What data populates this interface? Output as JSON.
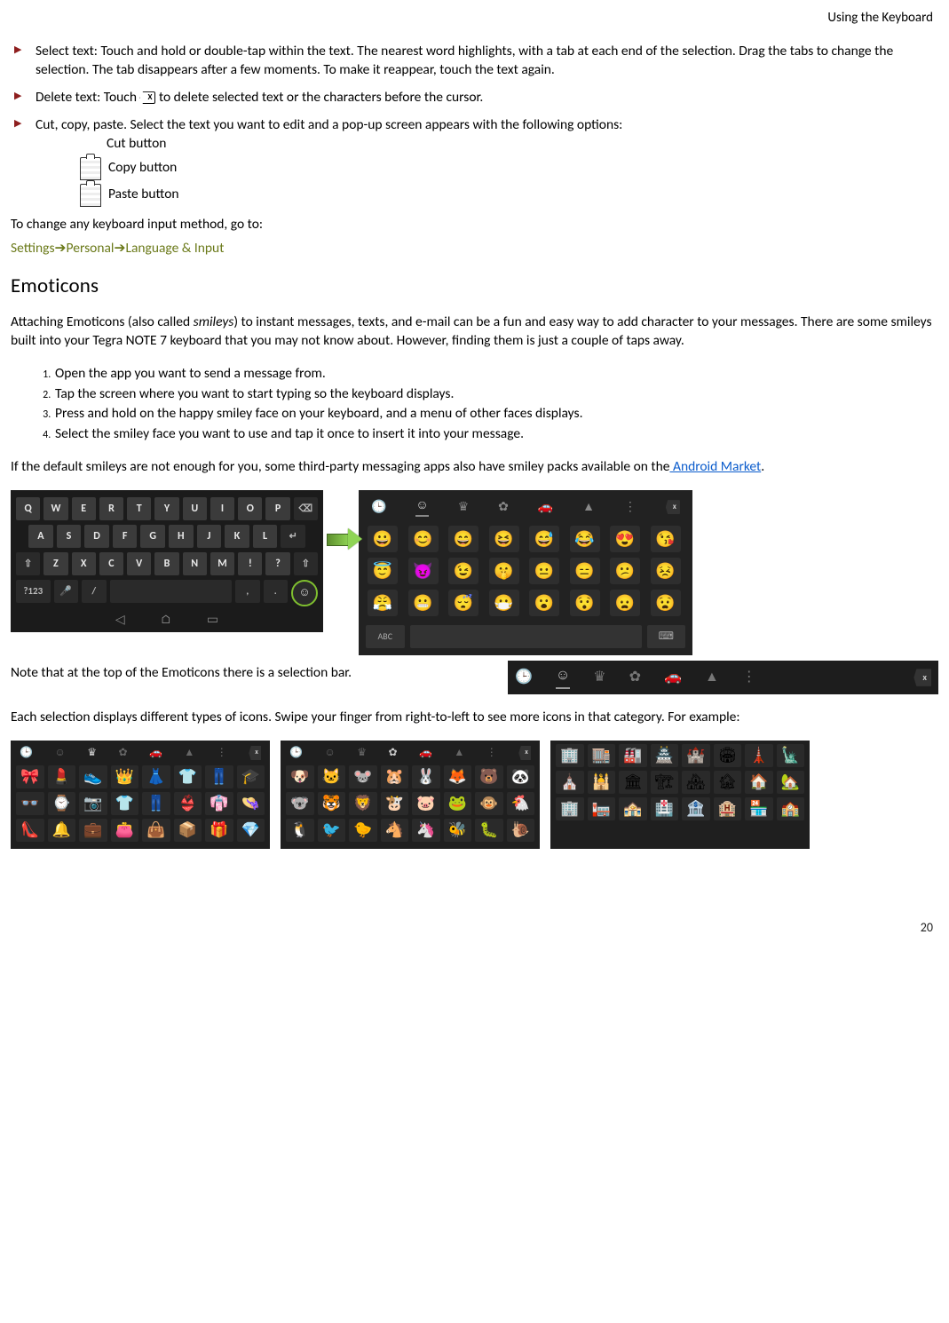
{
  "header": {
    "title": "Using the Keyboard"
  },
  "bullets": {
    "select": "Select text: Touch and hold or double-tap within the text. The nearest word highlights, with a tab at each end of the selection. Drag the tabs to change the selection. The tab disappears after a few moments. To make it reappear, touch the text again.",
    "delete_pre": "Delete text: Touch ",
    "delete_key": "X",
    "delete_post": " to delete selected text or the characters before the cursor.",
    "ccp": "Cut, copy, paste. Select the text you want to edit and a pop-up screen appears with the following options:",
    "cut": "Cut button",
    "copy": "Copy button",
    "paste": "Paste button"
  },
  "change_line": "To change any keyboard input method, go to:",
  "path": {
    "a": "Settings",
    "b": "Personal",
    "c": "Language & Input"
  },
  "section": "Emoticons",
  "intro_a": "Attaching Emoticons (also called ",
  "intro_em": "smileys",
  "intro_b": ") to instant messages, texts, and e-mail can be a fun and easy way to add character to your messages. There are some smileys built into your Tegra NOTE 7 keyboard that you may not know about. However, finding them is just a couple of taps away.",
  "steps": [
    "Open the app you want to send a message from.",
    "Tap the screen where you want to start typing so the keyboard displays.",
    "Press and hold on the happy smiley face on your keyboard, and a menu of other faces displays.",
    "Select the smiley face you want to use and tap it once to insert it into your message."
  ],
  "third_a": "If the default smileys are not enough for you, some third-party messaging apps also have smiley packs available on the",
  "third_link": " Android Market",
  "third_b": ".",
  "keyboard": {
    "row1": [
      "Q",
      "W",
      "E",
      "R",
      "T",
      "Y",
      "U",
      "I",
      "O",
      "P"
    ],
    "row2": [
      "A",
      "S",
      "D",
      "F",
      "G",
      "H",
      "J",
      "K",
      "L"
    ],
    "row3": [
      "Z",
      "X",
      "C",
      "V",
      "B",
      "N",
      "M",
      "!",
      "?"
    ],
    "bottom": {
      "sym": "?123",
      "mic": "🎤",
      "slash": "/",
      "comma": ",",
      "dot": ".",
      "smile": "☺"
    },
    "nav": {
      "back": "◁",
      "home": "⌂",
      "recent": "▭"
    }
  },
  "emoji_tabs": {
    "recent": "🕒",
    "face": "☺",
    "crown": "♛",
    "flower": "✿",
    "car": "🚗",
    "tri": "▲",
    "more": "⋮"
  },
  "emoji_faces": [
    "😀",
    "😊",
    "😄",
    "😆",
    "😅",
    "😂",
    "😍",
    "😘",
    "😇",
    "😈",
    "😉",
    "🤫",
    "😐",
    "😑",
    "😕",
    "😣",
    "😤",
    "😬",
    "😴",
    "😷",
    "😮",
    "😯",
    "😦",
    "😧"
  ],
  "note": "Note that at the top of the Emoticons there is a selection bar.",
  "swipe": "Each selection displays different types of icons. Swipe your finger from right-to-left to see more icons in that category. For example:",
  "panel1": [
    "🎀",
    "💄",
    "👟",
    "👑",
    "👗",
    "👕",
    "👖",
    "🎓",
    "👓",
    "⌚",
    "📷",
    "👕",
    "👖",
    "👙",
    "👘",
    "👒",
    "👠",
    "🔔",
    "💼",
    "👛",
    "👜",
    "📦",
    "🎁",
    "💎"
  ],
  "panel2": [
    "🐶",
    "🐱",
    "🐭",
    "🐹",
    "🐰",
    "🦊",
    "🐻",
    "🐼",
    "🐨",
    "🐯",
    "🦁",
    "🐮",
    "🐷",
    "🐸",
    "🐵",
    "🐔",
    "🐧",
    "🐦",
    "🐤",
    "🐴",
    "🦄",
    "🐝",
    "🐛",
    "🐌"
  ],
  "panel3": [
    "🏢",
    "🏬",
    "🏭",
    "🏯",
    "🏰",
    "🏟",
    "🗼",
    "🗽",
    "⛪",
    "🕌",
    "🏛",
    "🏗",
    "🏘",
    "🏚",
    "🏠",
    "🏡",
    "🏢",
    "🏣",
    "🏤",
    "🏥",
    "🏦",
    "🏨",
    "🏪",
    "🏫"
  ],
  "page": "20"
}
